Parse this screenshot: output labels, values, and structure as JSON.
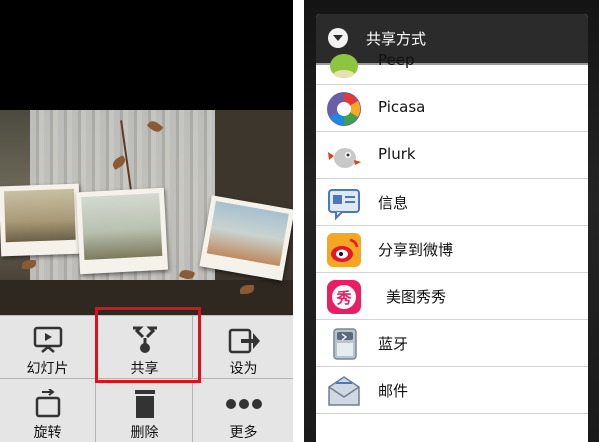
{
  "left": {
    "menu": [
      {
        "label": "幻灯片",
        "icon": "slideshow-icon"
      },
      {
        "label": "共享",
        "icon": "share-icon"
      },
      {
        "label": "设为",
        "icon": "set-as-icon"
      },
      {
        "label": "旋转",
        "icon": "rotate-icon"
      },
      {
        "label": "删除",
        "icon": "delete-icon"
      },
      {
        "label": "更多",
        "icon": "more-icon"
      }
    ],
    "highlight_color": "#e0101a"
  },
  "right": {
    "dialog_title": "共享方式",
    "items": [
      {
        "label": "Peep",
        "icon": "peep-icon"
      },
      {
        "label": "Picasa",
        "icon": "picasa-icon"
      },
      {
        "label": "Plurk",
        "icon": "plurk-icon"
      },
      {
        "label": "信息",
        "icon": "messaging-icon"
      },
      {
        "label": "分享到微博",
        "icon": "weibo-icon"
      },
      {
        "label": "美图秀秀",
        "icon": "meitu-icon"
      },
      {
        "label": "蓝牙",
        "icon": "bluetooth-icon"
      },
      {
        "label": "邮件",
        "icon": "email-icon"
      }
    ]
  }
}
